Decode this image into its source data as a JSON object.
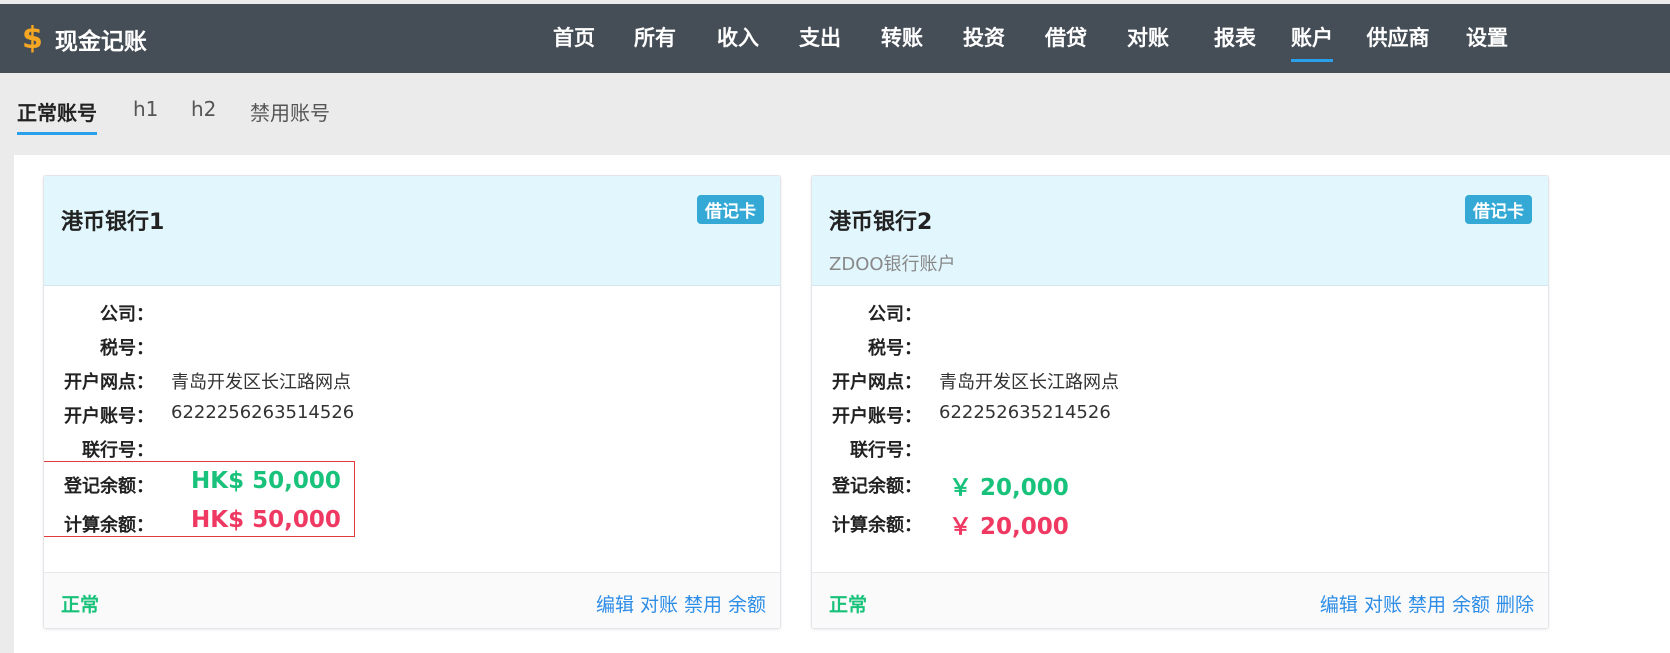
{
  "app": {
    "icon": "dollar-icon",
    "title": "现金记账"
  },
  "nav": {
    "items": [
      {
        "label": "首页"
      },
      {
        "label": "所有"
      },
      {
        "label": "收入"
      },
      {
        "label": "支出"
      },
      {
        "label": "转账"
      },
      {
        "label": "投资"
      },
      {
        "label": "借贷"
      },
      {
        "label": "对账"
      },
      {
        "label": "报表"
      },
      {
        "label": "账户",
        "active": true
      },
      {
        "label": "供应商"
      },
      {
        "label": "设置"
      }
    ]
  },
  "subtabs": [
    {
      "label": "正常账号",
      "active": true
    },
    {
      "label": "h1"
    },
    {
      "label": "h2"
    },
    {
      "label": "禁用账号"
    }
  ],
  "labels": {
    "company": "公司：",
    "tax": "税号：",
    "branch": "开户网点：",
    "account_no": "开户账号：",
    "bank_code": "联行号：",
    "recorded_balance": "登记余额：",
    "calculated_balance": "计算余额："
  },
  "cards": [
    {
      "title": "港币银行1",
      "subtitle": "",
      "badge": "借记卡",
      "company": "",
      "tax": "",
      "branch": "青岛开发区长江路网点",
      "account_no": "6222256263514526",
      "bank_code": "",
      "recorded_balance": "HK$ 50,000",
      "calculated_balance": "HK$ 50,000",
      "status": "正常",
      "actions": [
        "编辑",
        "对账",
        "禁用",
        "余额"
      ]
    },
    {
      "title": "港币银行2",
      "subtitle": "ZDOO银行账户",
      "badge": "借记卡",
      "company": "",
      "tax": "",
      "branch": "青岛开发区长江路网点",
      "account_no": "622252635214526",
      "bank_code": "",
      "recorded_balance": "￥ 20,000",
      "calculated_balance": "￥ 20,000",
      "status": "正常",
      "actions": [
        "编辑",
        "对账",
        "禁用",
        "余额",
        "删除"
      ]
    }
  ],
  "colors": {
    "topbar": "#454d56",
    "accent": "#2aa0ea",
    "positive": "#19c27a",
    "negative": "#ef3862",
    "badge": "#35a9d5"
  }
}
